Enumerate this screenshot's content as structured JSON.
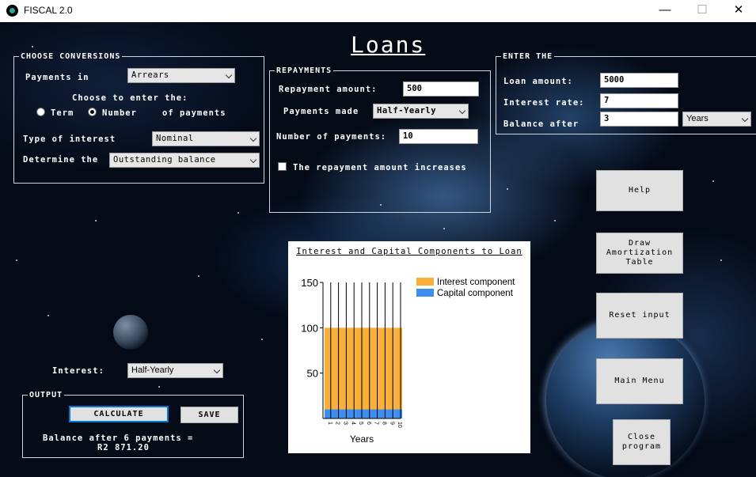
{
  "window": {
    "title": "FISCAL 2.0",
    "minimize": "—",
    "maximize": "☐",
    "close": "✕"
  },
  "heading": "Loans",
  "choose_conversions": {
    "legend": "CHOOSE CONVERSIONS",
    "payments_in_label": "Payments in",
    "payments_in_value": "Arrears",
    "choose_to_enter": "Choose to enter the:",
    "radio_term": "Term",
    "radio_number": "Number",
    "of_payments": "of payments",
    "selected_radio": "Number",
    "type_of_interest_label": "Type of interest",
    "type_of_interest_value": "Nominal",
    "determine_label": "Determine the",
    "determine_value": "Outstanding balance"
  },
  "repayments": {
    "legend": "REPAYMENTS",
    "amount_label": "Repayment amount:",
    "amount_value": "500",
    "made_label": "Payments made",
    "made_value": "Half-Yearly",
    "number_label": "Number of payments:",
    "number_value": "10",
    "increases_label": "The repayment amount increases",
    "increases_checked": false
  },
  "enter_the": {
    "legend": "ENTER THE",
    "loan_amount_label": "Loan amount:",
    "loan_amount_value": "5000",
    "interest_rate_label": "Interest rate:",
    "interest_rate_value": "7",
    "balance_after_label": "Balance after",
    "balance_after_value": "3",
    "balance_unit": "Years"
  },
  "interest": {
    "label": "Interest:",
    "value": "Half-Yearly"
  },
  "output": {
    "legend": "OUTPUT",
    "calculate": "CALCULATE",
    "save": "SAVE",
    "result_line1": "Balance after 6 payments =",
    "result_line2": "R2 871.20"
  },
  "buttons": {
    "help": "Help",
    "draw_amortization": "Draw Amortization Table",
    "reset": "Reset input",
    "main_menu": "Main Menu",
    "close_program": "Close program"
  },
  "colors": {
    "interest": "#f8b03b",
    "capital": "#3d8ef0",
    "primary_border": "#0078d7"
  },
  "chart_data": {
    "type": "bar",
    "stacked": true,
    "title": "Interest and Capital Components to Loan",
    "xlabel": "Years",
    "ylabel": "",
    "ylim": [
      0,
      150
    ],
    "yticks": [
      50,
      100,
      150
    ],
    "categories": [
      "1",
      "2",
      "3",
      "4",
      "5",
      "6",
      "7",
      "8",
      "9",
      "10"
    ],
    "series": [
      {
        "name": "Capital component",
        "values": [
          10,
          10,
          10,
          10,
          10,
          10,
          10,
          10,
          10,
          10
        ]
      },
      {
        "name": "Interest component",
        "values": [
          90,
          90,
          90,
          90,
          90,
          90,
          90,
          90,
          90,
          90
        ]
      }
    ],
    "legend_position": "top-right"
  }
}
